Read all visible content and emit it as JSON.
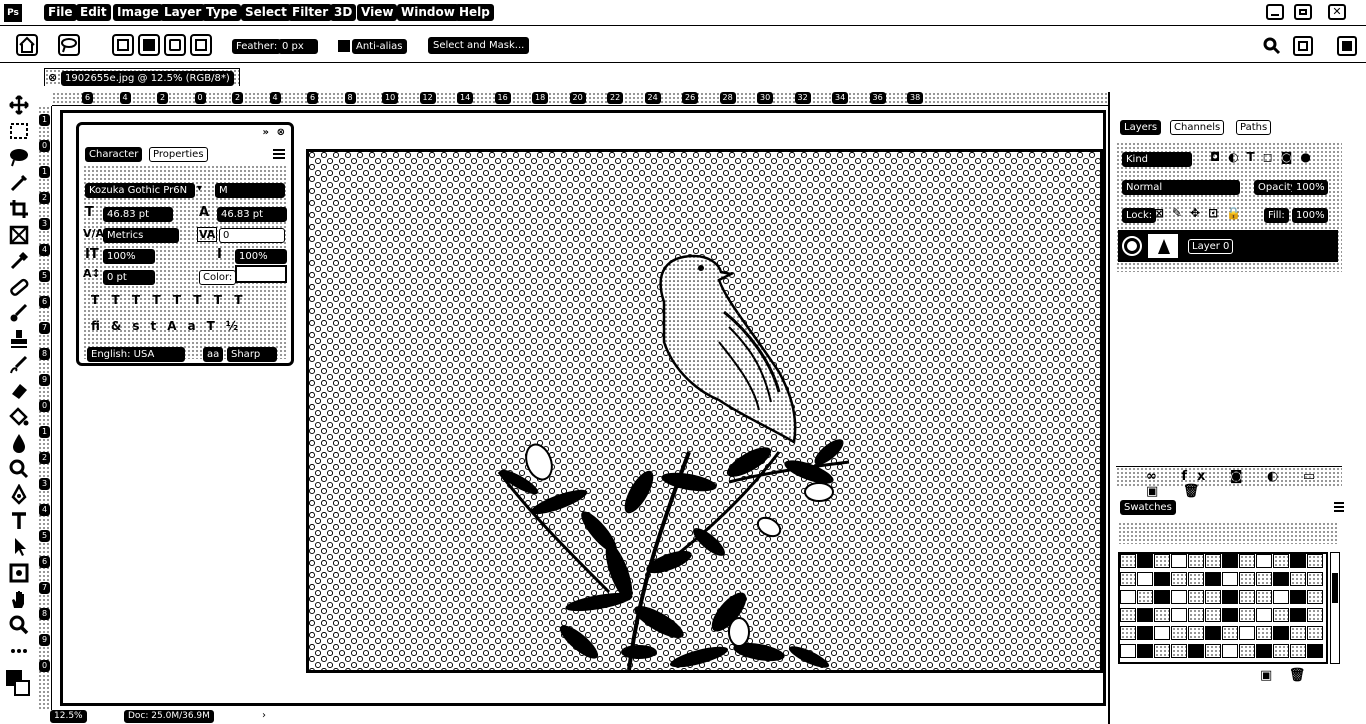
{
  "app": {
    "logo": "Ps"
  },
  "menu": [
    "File",
    "Edit",
    "Image",
    "Layer",
    "Type",
    "Select",
    "Filter",
    "3D",
    "View",
    "Window",
    "Help"
  ],
  "options": {
    "feather_label": "Feather:",
    "feather_value": "0 px",
    "antialias_label": "Anti-alias",
    "select_mask_label": "Select and Mask..."
  },
  "document": {
    "tab_title": "1902655e.jpg @ 12.5% (RGB/8*)"
  },
  "ruler_top": [
    "6",
    "4",
    "2",
    "0",
    "2",
    "4",
    "6",
    "8",
    "10",
    "12",
    "14",
    "16",
    "18",
    "20",
    "22",
    "24",
    "26",
    "28",
    "30",
    "32",
    "34",
    "36",
    "38"
  ],
  "ruler_left": [
    "1",
    "0",
    "1",
    "2",
    "3",
    "4",
    "5",
    "6",
    "7",
    "8",
    "9",
    "0",
    "1",
    "2",
    "3",
    "4",
    "5",
    "6",
    "7",
    "8",
    "9",
    "0"
  ],
  "character": {
    "tab_character": "Character",
    "tab_properties": "Properties",
    "font_family": "Kozuka Gothic Pr6N",
    "font_style": "M",
    "size": "46.83 pt",
    "leading": "46.83 pt",
    "kerning": "Metrics",
    "tracking": "0",
    "vscale": "100%",
    "hscale": "100%",
    "baseline": "0 pt",
    "color_label": "Color:",
    "language": "English: USA",
    "aa_label": "aa",
    "aa_value": "Sharp"
  },
  "layers": {
    "tab_layers": "Layers",
    "tab_channels": "Channels",
    "tab_paths": "Paths",
    "kind": "Kind",
    "blend_mode": "Normal",
    "opacity_label": "Opacity:",
    "opacity": "100%",
    "lock_label": "Lock:",
    "fill_label": "Fill:",
    "fill": "100%",
    "layer_name": "Layer 0"
  },
  "swatches": {
    "tab": "Swatches"
  },
  "status": {
    "zoom": "12.5%",
    "doc": "Doc: 25.0M/36.9M"
  }
}
